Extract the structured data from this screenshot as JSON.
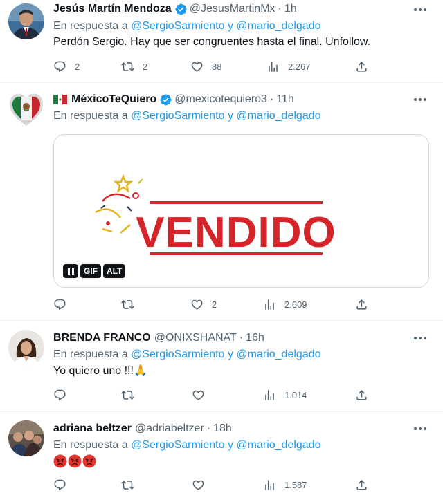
{
  "tweets": [
    {
      "name": "Jesús Martín Mendoza",
      "handle": "@JesusMartinMx",
      "dot": "·",
      "time": "1h",
      "reply_prefix": "En respuesta a",
      "mention_1": "@SergioSarmiento",
      "conj": "y",
      "mention_2": "@mario_delgado",
      "text": "Perdón Sergio. Hay que ser congruentes hasta el final. Unfollow.",
      "replies": "2",
      "retweets": "2",
      "likes": "88",
      "views": "2.267"
    },
    {
      "name": "MéxicoTeQuiero",
      "handle": "@mexicotequiero3",
      "dot": "·",
      "time": "11h",
      "reply_prefix": "En respuesta a",
      "mention_1": "@SergioSarmiento",
      "conj": "y",
      "mention_2": "@mario_delgado",
      "media_text": "VENDIDO",
      "badge_gif": "GIF",
      "badge_alt": "ALT",
      "replies": "",
      "retweets": "",
      "likes": "2",
      "views": "2.609"
    },
    {
      "name": "BRENDA FRANCO",
      "handle": "@ONIXSHANAT",
      "dot": "·",
      "time": "16h",
      "reply_prefix": "En respuesta a",
      "mention_1": "@SergioSarmiento",
      "conj": "y",
      "mention_2": "@mario_delgado",
      "text": "Yo quiero uno !!!🙏",
      "replies": "",
      "retweets": "",
      "likes": "",
      "views": "1.014"
    },
    {
      "name": "adriana beltzer",
      "handle": "@adriabeltzer",
      "dot": "·",
      "time": "18h",
      "reply_prefix": "En respuesta a",
      "mention_1": "@SergioSarmiento",
      "conj": "y",
      "mention_2": "@mario_delgado",
      "replies": "",
      "retweets": "",
      "likes": "",
      "views": "1.587"
    }
  ],
  "colors": {
    "link": "#1d9bf0",
    "muted": "#536471",
    "text": "#0f1419",
    "vendido_red": "#d4252a"
  },
  "icons": [
    "reply-icon",
    "retweet-icon",
    "like-icon",
    "views-icon",
    "share-icon",
    "verified-icon",
    "more-icon",
    "pause-icon",
    "mexico-flag-icon",
    "angry-face-icon"
  ]
}
